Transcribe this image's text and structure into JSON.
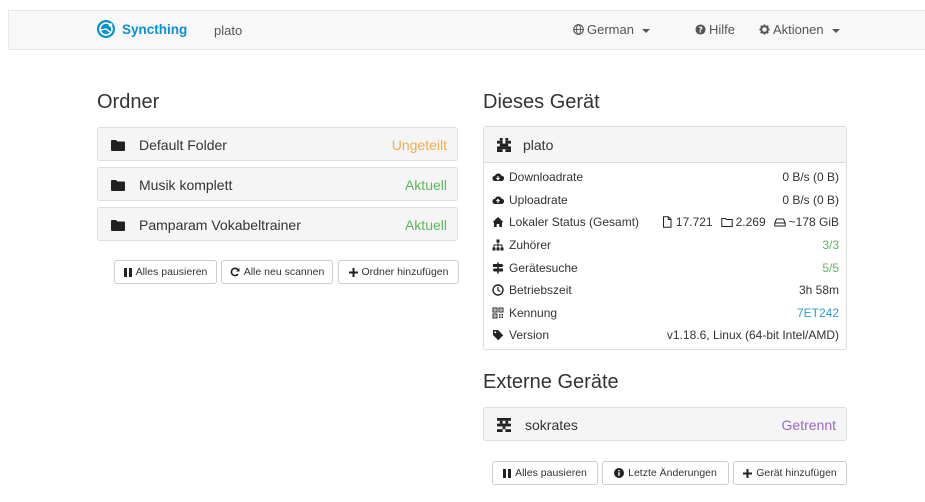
{
  "navbar": {
    "brand": "Syncthing",
    "device_name": "plato",
    "language": "German",
    "help": "Hilfe",
    "actions": "Aktionen"
  },
  "folders": {
    "title": "Ordner",
    "items": [
      {
        "name": "Default Folder",
        "status": "Ungeteilt"
      },
      {
        "name": "Musik komplett",
        "status": "Aktuell"
      },
      {
        "name": "Pamparam Vokabeltrainer",
        "status": "Aktuell"
      }
    ],
    "buttons": {
      "pause_all": "Alles pausieren",
      "rescan_all": "Alle neu scannen",
      "add_folder": "Ordner hinzufügen"
    }
  },
  "this_device": {
    "title": "Dieses Gerät",
    "name": "plato",
    "rows": {
      "download_label": "Downloadrate",
      "download_value": "0 B/s (0 B)",
      "upload_label": "Uploadrate",
      "upload_value": "0 B/s (0 B)",
      "local_label": "Lokaler Status (Gesamt)",
      "local_files": "17.721",
      "local_dirs": "2.269",
      "local_size": "~178 GiB",
      "listeners_label": "Zuhörer",
      "listeners_value": "3/3",
      "discovery_label": "Gerätesuche",
      "discovery_value": "5/5",
      "uptime_label": "Betriebszeit",
      "uptime_value": "3h 58m",
      "id_label": "Kennung",
      "id_value": "7ET242",
      "version_label": "Version",
      "version_value": "v1.18.6, Linux (64-bit Intel/AMD)"
    }
  },
  "remote_devices": {
    "title": "Externe Geräte",
    "items": [
      {
        "name": "sokrates",
        "status": "Getrennt"
      }
    ],
    "buttons": {
      "pause_all": "Alles pausieren",
      "recent_changes": "Letzte Änderungen",
      "add_device": "Gerät hinzufügen"
    }
  },
  "colors": {
    "brand": "#0891d1",
    "up_to_date": "#5cb85c",
    "unshared": "#f0ad4e",
    "disconnected": "#9b69c9",
    "link": "#2a9fd6"
  }
}
